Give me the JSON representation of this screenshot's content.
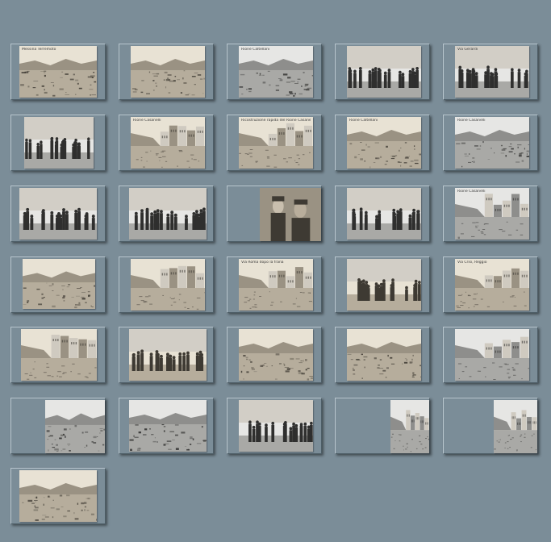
{
  "gallery": {
    "thumbnails": [
      {
        "caption": "Messina Terremoto",
        "scene": "ruins",
        "tone": "sepia"
      },
      {
        "caption": "",
        "scene": "ruins",
        "tone": "sepia"
      },
      {
        "caption": "Rione Caltellani",
        "scene": "ruins",
        "tone": "gray"
      },
      {
        "caption": "",
        "scene": "crowd",
        "tone": "gray"
      },
      {
        "caption": "Via Gerardi",
        "scene": "crowd",
        "tone": "gray"
      },
      {
        "caption": "",
        "scene": "crowd",
        "tone": "gray"
      },
      {
        "caption": "Rione Casanelli",
        "scene": "street",
        "tone": "sepia"
      },
      {
        "caption": "Ricostruzione rapida del Rione Casanelli",
        "scene": "street",
        "tone": "sepia"
      },
      {
        "caption": "Rione Caltellani",
        "scene": "ruins",
        "tone": "sepia"
      },
      {
        "caption": "Rione Casanelli",
        "scene": "ruins",
        "tone": "gray"
      },
      {
        "caption": "",
        "scene": "crowd",
        "tone": "gray"
      },
      {
        "caption": "",
        "scene": "crowd",
        "tone": "gray"
      },
      {
        "caption": "",
        "scene": "portrait",
        "tone": "sepia"
      },
      {
        "caption": "",
        "scene": "crowd",
        "tone": "gray"
      },
      {
        "caption": "Rione Casanelli",
        "scene": "street",
        "tone": "gray"
      },
      {
        "caption": "",
        "scene": "ruins",
        "tone": "sepia"
      },
      {
        "caption": "",
        "scene": "street",
        "tone": "sepia"
      },
      {
        "caption": "Via Roma dopo la frana",
        "scene": "street",
        "tone": "sepia"
      },
      {
        "caption": "",
        "scene": "crowd",
        "tone": "sepia"
      },
      {
        "caption": "Via Crisi, Reggio",
        "scene": "street",
        "tone": "sepia"
      },
      {
        "caption": "",
        "scene": "street",
        "tone": "sepia"
      },
      {
        "caption": "",
        "scene": "crowd",
        "tone": "sepia"
      },
      {
        "caption": "",
        "scene": "ruins",
        "tone": "sepia"
      },
      {
        "caption": "",
        "scene": "ruins",
        "tone": "sepia"
      },
      {
        "caption": "",
        "scene": "street",
        "tone": "gray"
      },
      {
        "caption": "",
        "scene": "ruins",
        "tone": "gray"
      },
      {
        "caption": "",
        "scene": "ruins",
        "tone": "gray"
      },
      {
        "caption": "",
        "scene": "crowd",
        "tone": "gray"
      },
      {
        "caption": "",
        "scene": "street",
        "tone": "gray"
      },
      {
        "caption": "",
        "scene": "street",
        "tone": "gray"
      },
      {
        "caption": "",
        "scene": "ruins",
        "tone": "sepia"
      }
    ]
  }
}
